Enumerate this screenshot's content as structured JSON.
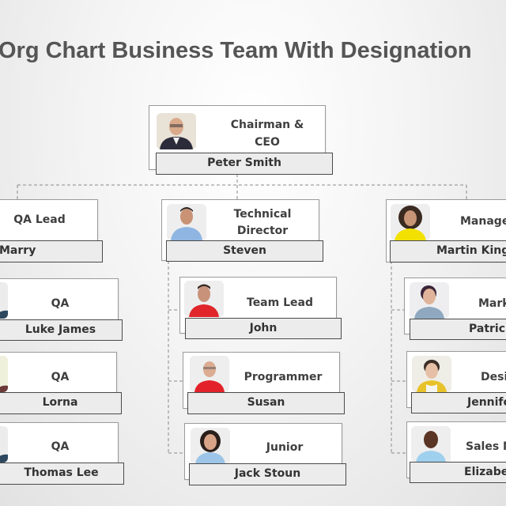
{
  "title": "Org Chart Business  Team With Designation",
  "root": {
    "role_line1": "Chairman  &",
    "role_line2": "CEO",
    "name": "Peter Smith",
    "avatar": "avatar-man-glasses-suit"
  },
  "level1": [
    {
      "role_line1": "QA Lead",
      "role_line2": "",
      "name": "Marry",
      "avatar": ""
    },
    {
      "role_line1": "Technical",
      "role_line2": "Director",
      "name": "Steven",
      "avatar": "avatar-man-blue-shirt"
    },
    {
      "role_line1": "Manager",
      "role_line2": "",
      "name": "Martin King",
      "avatar": "avatar-woman-curly-yellow"
    }
  ],
  "left_team": [
    {
      "role": "QA",
      "name": "Luke James"
    },
    {
      "role": "QA",
      "name": "Lorna"
    },
    {
      "role": "QA",
      "name": "Thomas Lee"
    }
  ],
  "center_team": [
    {
      "role": "Team Lead",
      "name": "John"
    },
    {
      "role": "Programmer",
      "name": "Susan"
    },
    {
      "role": "Junior",
      "name": "Jack Stoun"
    }
  ],
  "right_team": [
    {
      "role": "Marketing",
      "name": "Patrick"
    },
    {
      "role": "Designer",
      "name": "Jennifer"
    },
    {
      "role": "Sales Manager",
      "name": "Elizabeth"
    }
  ],
  "colors": {
    "title": "#555555",
    "connector": "#8a8a8a",
    "namebar_bg": "#ececec",
    "namebar_border": "#4a4a4a"
  }
}
